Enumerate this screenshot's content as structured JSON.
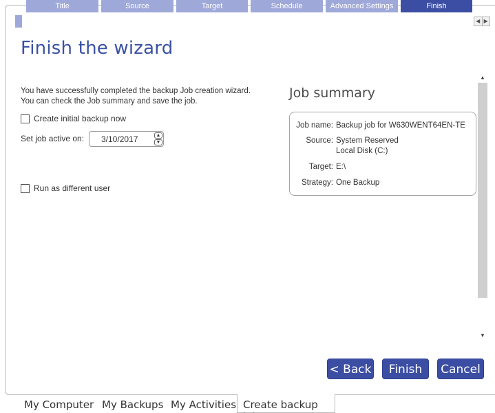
{
  "wizard_steps": [
    {
      "label": "Title",
      "active": false
    },
    {
      "label": "Source",
      "active": false
    },
    {
      "label": "Target",
      "active": false
    },
    {
      "label": "Schedule",
      "active": false
    },
    {
      "label": "Advanced Settings",
      "active": false
    },
    {
      "label": "Finish",
      "active": true
    }
  ],
  "page_title": "Finish the wizard",
  "intro": {
    "line1": "You have successfully completed the backup Job creation wizard.",
    "line2": "You can check the Job summary and save the job."
  },
  "options": {
    "create_initial_backup": {
      "label": "Create initial backup now",
      "checked": false
    },
    "set_active_label": "Set job active on:",
    "active_date": "3/10/2017",
    "run_as_user": {
      "label": "Run as different user",
      "checked": false
    }
  },
  "summary": {
    "title": "Job summary",
    "job_name_key": "Job name:",
    "job_name": "Backup job for W630WENT64EN-TE",
    "source_key": "Source:",
    "source_1": "System Reserved",
    "source_2": "Local Disk (C:)",
    "target_key": "Target:",
    "target": "E:\\",
    "strategy_key": "Strategy:",
    "strategy": "One Backup"
  },
  "buttons": {
    "back": "< Back",
    "finish": "Finish",
    "cancel": "Cancel"
  },
  "bottom_tabs": [
    {
      "label": "My Computer",
      "active": false
    },
    {
      "label": "My Backups",
      "active": false
    },
    {
      "label": "My Activities",
      "active": false
    },
    {
      "label": "Create backup job",
      "active": true
    }
  ],
  "colors": {
    "accent": "#3c4ea3",
    "step_inactive": "#9fa9d9",
    "title": "#3a51a3"
  }
}
